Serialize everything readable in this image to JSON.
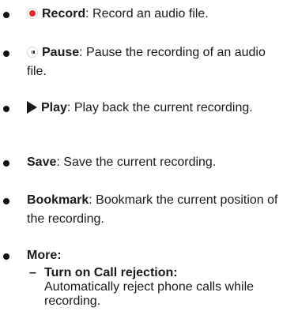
{
  "items": [
    {
      "icon": "record-icon",
      "label": "Record",
      "sep": ": ",
      "desc": "Record an audio file."
    },
    {
      "icon": "pause-icon",
      "label": "Pause",
      "sep": ": ",
      "desc": "Pause the recording of an audio file."
    },
    {
      "icon": "play-icon",
      "label": "Play",
      "sep": ": ",
      "desc": "Play back the current recording."
    },
    {
      "label": "Save",
      "sep": ": ",
      "desc": "Save the current recording."
    },
    {
      "label": "Bookmark",
      "sep": ": ",
      "desc": "Bookmark the current position of the recording."
    },
    {
      "label": "More",
      "sep": ":"
    }
  ],
  "subitems": [
    {
      "marker": "–",
      "label": "Turn on Call rejection",
      "sep": ":",
      "desc": "Automatically reject phone calls while recording."
    }
  ],
  "colors": {
    "record_red": "#e8262b",
    "text": "#1a1a1a"
  }
}
